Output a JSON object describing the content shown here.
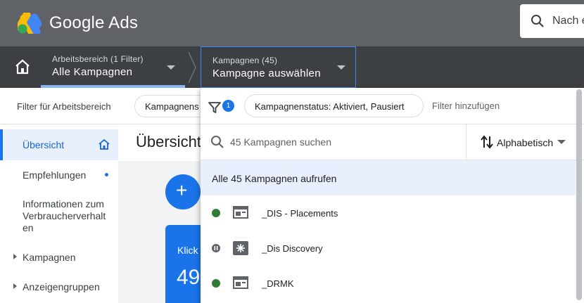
{
  "app": {
    "brand": "Google Ads",
    "search_placeholder": "Nach e"
  },
  "nav": {
    "workspace_label": "Arbeitsbereich (1 Filter)",
    "workspace_value": "Alle Kampagnen",
    "campaign_label": "Kampagnen (45)",
    "campaign_value": "Kampagne auswählen"
  },
  "filter_bar": {
    "label": "Filter für Arbeitsbereich",
    "chip_partial": "Kampagnens"
  },
  "sidebar": {
    "items": [
      {
        "label": "Übersicht",
        "active": true
      },
      {
        "label": "Empfehlungen"
      },
      {
        "label": "Informationen zum Verbraucherverhalten"
      },
      {
        "label": "Kampagnen"
      },
      {
        "label": "Anzeigengruppen"
      }
    ],
    "consumer_lines": [
      "Informationen zum",
      "Verbraucherverhalt",
      "en"
    ]
  },
  "main": {
    "title": "Übersicht",
    "fab_label": "+",
    "card_label": "Klick",
    "card_value": "49"
  },
  "dropdown": {
    "filter_badge": "1",
    "status_chip": "Kampagnenstatus: Aktiviert, Pausiert",
    "add_filter": "Filter hinzufügen",
    "search_placeholder": "45 Kampagnen suchen",
    "sort_label": "Alphabetisch",
    "all_campaigns": "Alle 45 Kampagnen aufrufen",
    "campaigns": [
      {
        "name": "_DIS - Placements",
        "status": "enabled",
        "type": "display-icon"
      },
      {
        "name": "_Dis Discovery",
        "status": "paused",
        "type": "discovery-icon"
      },
      {
        "name": "_DRMK",
        "status": "enabled",
        "type": "display-icon"
      }
    ]
  },
  "colors": {
    "topbar": "#5f6368",
    "navbar": "#3c4043",
    "accent": "#1a73e8",
    "enabled": "#2e7d32",
    "paused": "#5f6368",
    "highlight": "#e8f0fe"
  }
}
